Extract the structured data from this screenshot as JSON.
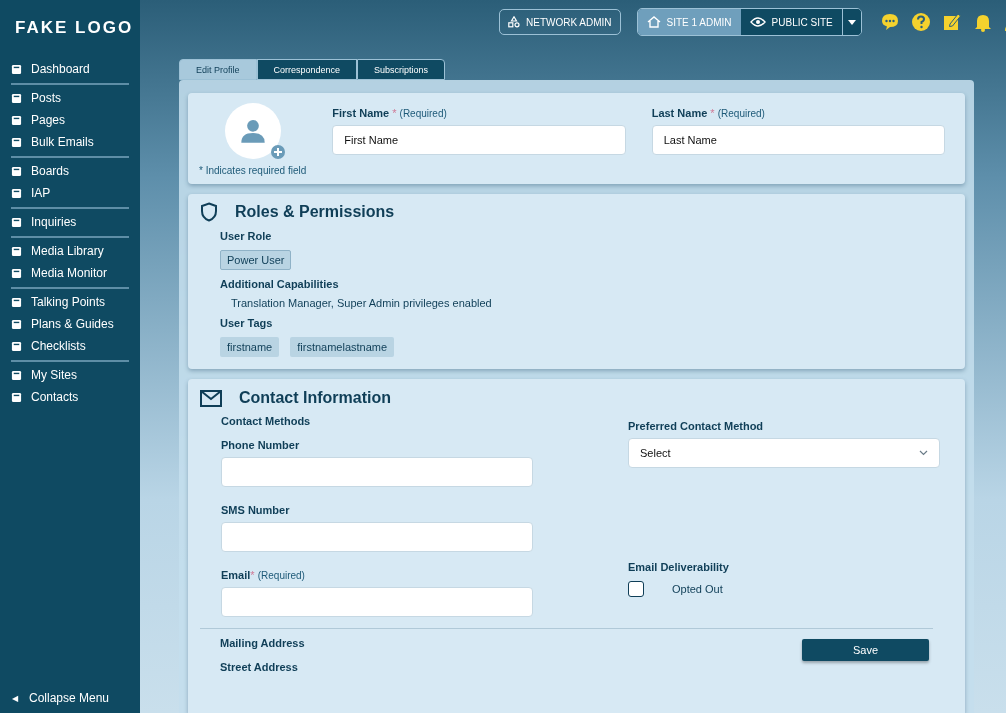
{
  "sidebar": {
    "logo": "FAKE LOGO",
    "groups": [
      [
        {
          "label": "Dashboard"
        }
      ],
      [
        {
          "label": "Posts"
        },
        {
          "label": "Pages"
        },
        {
          "label": "Bulk Emails"
        }
      ],
      [
        {
          "label": "Boards"
        },
        {
          "label": "IAP"
        }
      ],
      [
        {
          "label": "Inquiries"
        }
      ],
      [
        {
          "label": "Media Library"
        },
        {
          "label": "Media Monitor"
        }
      ],
      [
        {
          "label": "Talking Points"
        },
        {
          "label": "Plans & Guides"
        },
        {
          "label": "Checklists"
        }
      ],
      [
        {
          "label": "My Sites"
        },
        {
          "label": "Contacts"
        }
      ]
    ],
    "collapse": {
      "arrow": "◀",
      "label": "Collapse Menu"
    }
  },
  "topbar": {
    "network_admin": "NETWORK ADMIN",
    "sites": [
      {
        "label": "SITE 1 ADMIN",
        "selected": true
      },
      {
        "label": "PUBLIC SITE",
        "selected": false
      }
    ]
  },
  "tabs": [
    {
      "label": "Edit Profile",
      "selected": true
    },
    {
      "label": "Correspondence",
      "selected": false
    },
    {
      "label": "Subscriptions",
      "selected": false
    }
  ],
  "profile": {
    "required_note": "* Indicates required field",
    "fields": [
      {
        "label": "First Name",
        "mark": "*",
        "hint": "(Required)",
        "value": "First Name"
      },
      {
        "label": "Last Name",
        "mark": "*",
        "hint": "(Required)",
        "value": "Last Name"
      }
    ]
  },
  "roles": {
    "title": "Roles & Permissions",
    "role_label": "User Role",
    "role": "Power User",
    "capabilities_label": "Additional Capabilities",
    "capabilities": "Translation Manager, Super Admin privileges enabled",
    "tags_label": "User Tags",
    "tags": [
      "firstname",
      "firstnamelastname"
    ]
  },
  "contact": {
    "title": "Contact Information",
    "methods_label": "Contact Methods",
    "fields": [
      {
        "label": "Phone Number"
      },
      {
        "label": "SMS Number"
      },
      {
        "label": "Email",
        "mark": "*",
        "hint": "(Required)"
      }
    ],
    "preferred": {
      "label": "Preferred Contact Method",
      "value": "Select"
    },
    "deliverability": {
      "label": "Email Deliverability",
      "option": "Opted Out",
      "checked": false
    },
    "mailing_label": "Mailing Address",
    "street_label": "Street Address",
    "save": "Save"
  }
}
